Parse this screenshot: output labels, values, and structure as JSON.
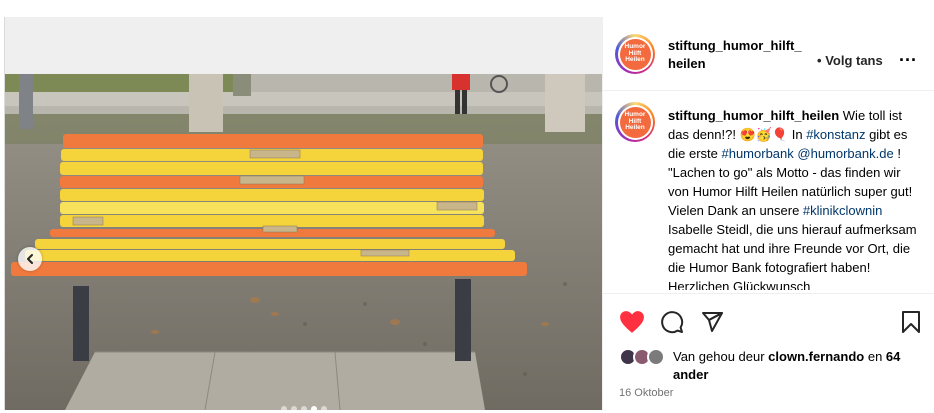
{
  "post": {
    "author": "stiftung_humor_hilft_heilen",
    "author_line1": "stiftung_humor_hilft_",
    "author_line2": "heilen",
    "follow_separator": "•",
    "follow_label": "Volg tans",
    "more_label": "...",
    "avatar_text": "Humor Hilft Heilen",
    "caption": {
      "author": "stiftung_humor_hilft_heilen",
      "text_1": " Wie toll ist das denn!?! 😍🥳🎈 In ",
      "tag_1": "#konstanz",
      "text_2": " gibt es die erste ",
      "tag_2": "#humorbank",
      "text_3": " ",
      "mention_1": "@humorbank.de",
      "text_4": " ! \"Lachen to go\" als Motto - das finden wir von Humor Hilft Heilen natürlich super gut! Vielen Dank an unsere ",
      "tag_3": "#klinikclownin",
      "text_5": " Isabelle Steidl, die uns hierauf aufmerksam gemacht hat und ihre Freunde vor Ort, die die Humor Bank fotografiert haben! Herzlichen Glückwunsch"
    },
    "likes": {
      "prefix": "Van gehou deur ",
      "user": "clown.fernando",
      "middle": " en ",
      "count": "64",
      "suffix": "ander"
    },
    "date": "16 Oktober",
    "carousel": {
      "count": 5,
      "active": 3
    }
  },
  "colors": {
    "like_red": "#ff3040",
    "bench_orange": "#f07a3e",
    "bench_yellow": "#f5d33a",
    "hashtag_blue": "#00376b"
  },
  "icons": [
    "chevron-left-icon",
    "heart-icon",
    "comment-icon",
    "share-icon",
    "bookmark-icon",
    "more-icon"
  ]
}
